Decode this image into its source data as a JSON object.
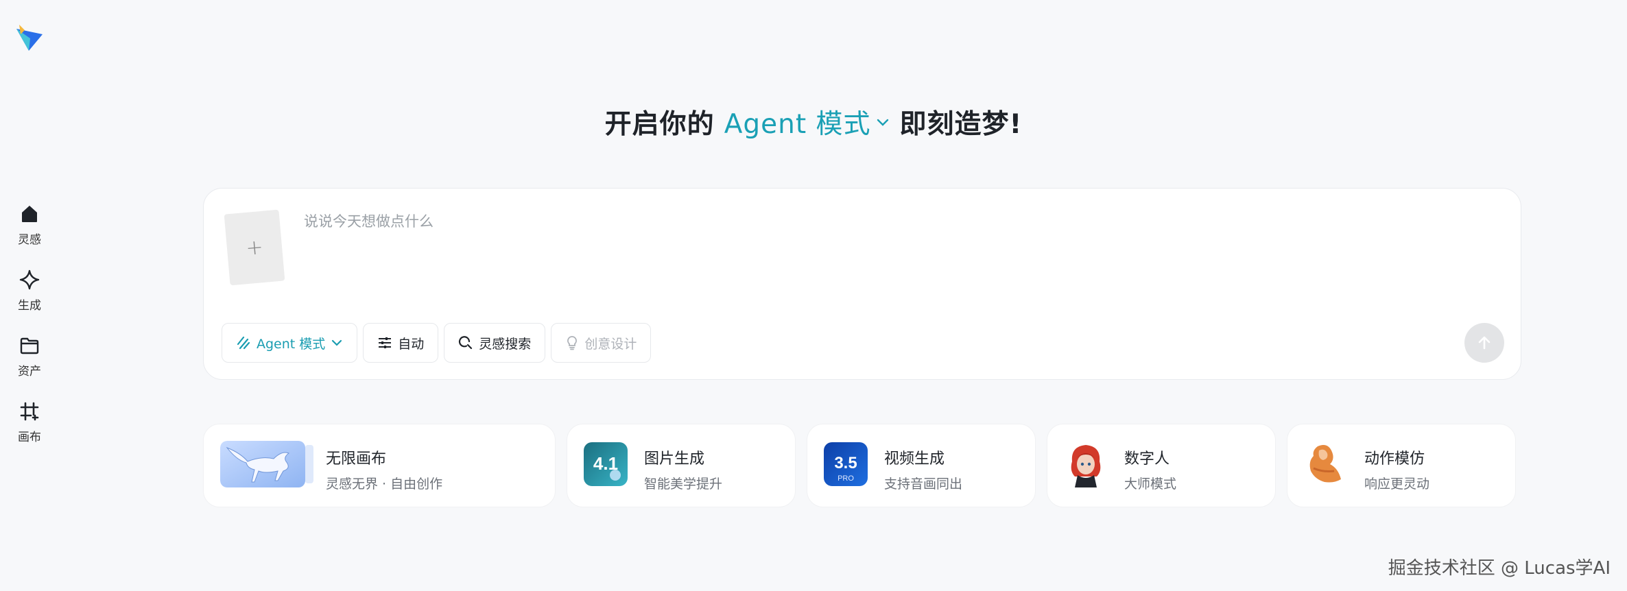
{
  "brand": {
    "logo_icon": "paper-plane-logo-icon",
    "colors": {
      "accent": "#1aa0b5",
      "logo_blue": "#2a6fe8",
      "logo_cyan": "#43c3d9",
      "logo_yellow": "#f5b83d"
    }
  },
  "sidebar": {
    "items": [
      {
        "icon": "home-icon",
        "label": "灵感"
      },
      {
        "icon": "sparkle-icon",
        "label": "生成"
      },
      {
        "icon": "folder-icon",
        "label": "资产"
      },
      {
        "icon": "canvas-frame-icon",
        "label": "画布"
      }
    ]
  },
  "heading": {
    "before": "开启你的",
    "mode": "Agent 模式",
    "after": "即刻造梦!"
  },
  "prompt": {
    "placeholder": "说说今天想做点什么",
    "upload_label": "+",
    "chips": [
      {
        "icon": "agent-icon",
        "label": "Agent 模式",
        "state": "active"
      },
      {
        "icon": "sliders-icon",
        "label": "自动",
        "state": "normal"
      },
      {
        "icon": "search-refresh-icon",
        "label": "灵感搜索",
        "state": "normal"
      },
      {
        "icon": "bulb-icon",
        "label": "创意设计",
        "state": "disabled"
      }
    ],
    "send_icon": "arrow-up-icon"
  },
  "features": [
    {
      "title": "无限画布",
      "subtitle": "灵感无界 · 自由创作",
      "thumb": "pegasus-thumbnail"
    },
    {
      "title": "图片生成",
      "subtitle": "智能美学提升",
      "badge": "4.1"
    },
    {
      "title": "视频生成",
      "subtitle": "支持音画同出",
      "badge": "3.5",
      "badge_sub": "PRO"
    },
    {
      "title": "数字人",
      "subtitle": "大师模式",
      "thumb": "red-hair-avatar-thumbnail"
    },
    {
      "title": "动作模仿",
      "subtitle": "响应更灵动",
      "thumb": "dancer-thumbnail"
    }
  ],
  "watermark": "掘金技术社区 @ Lucas学AI"
}
